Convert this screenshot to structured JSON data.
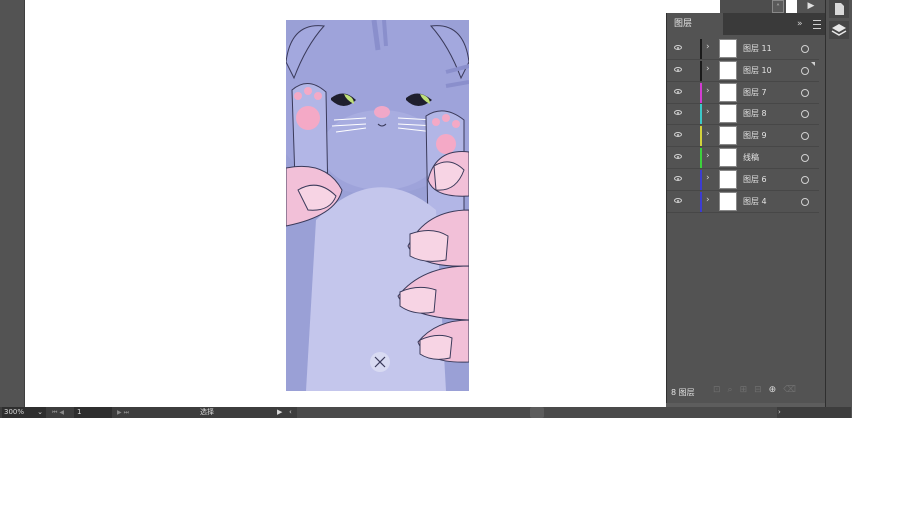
{
  "statusbar": {
    "zoom": "300%",
    "page": "1",
    "tool": "选择"
  },
  "layers_panel": {
    "tab_label": "图层",
    "collapse_label": "»",
    "footer_count": "8 图层",
    "layers": [
      {
        "name": "图层 11",
        "color": "#1a1a1a"
      },
      {
        "name": "图层 10",
        "color": "#1a1a1a"
      },
      {
        "name": "图层 7",
        "color": "#d23cd2"
      },
      {
        "name": "图层 8",
        "color": "#3cc8c8"
      },
      {
        "name": "图层 9",
        "color": "#d2d23c"
      },
      {
        "name": "线稿",
        "color": "#3cd23c"
      },
      {
        "name": "图层 6",
        "color": "#3c3cd2"
      },
      {
        "name": "图层 4",
        "color": "#3c3cd2"
      }
    ]
  },
  "icons": [
    "eye-icon",
    "chevron-right-icon",
    "target-circle-icon",
    "panel-menu-icon",
    "layers-icon",
    "play-icon",
    "close-x-icon"
  ]
}
